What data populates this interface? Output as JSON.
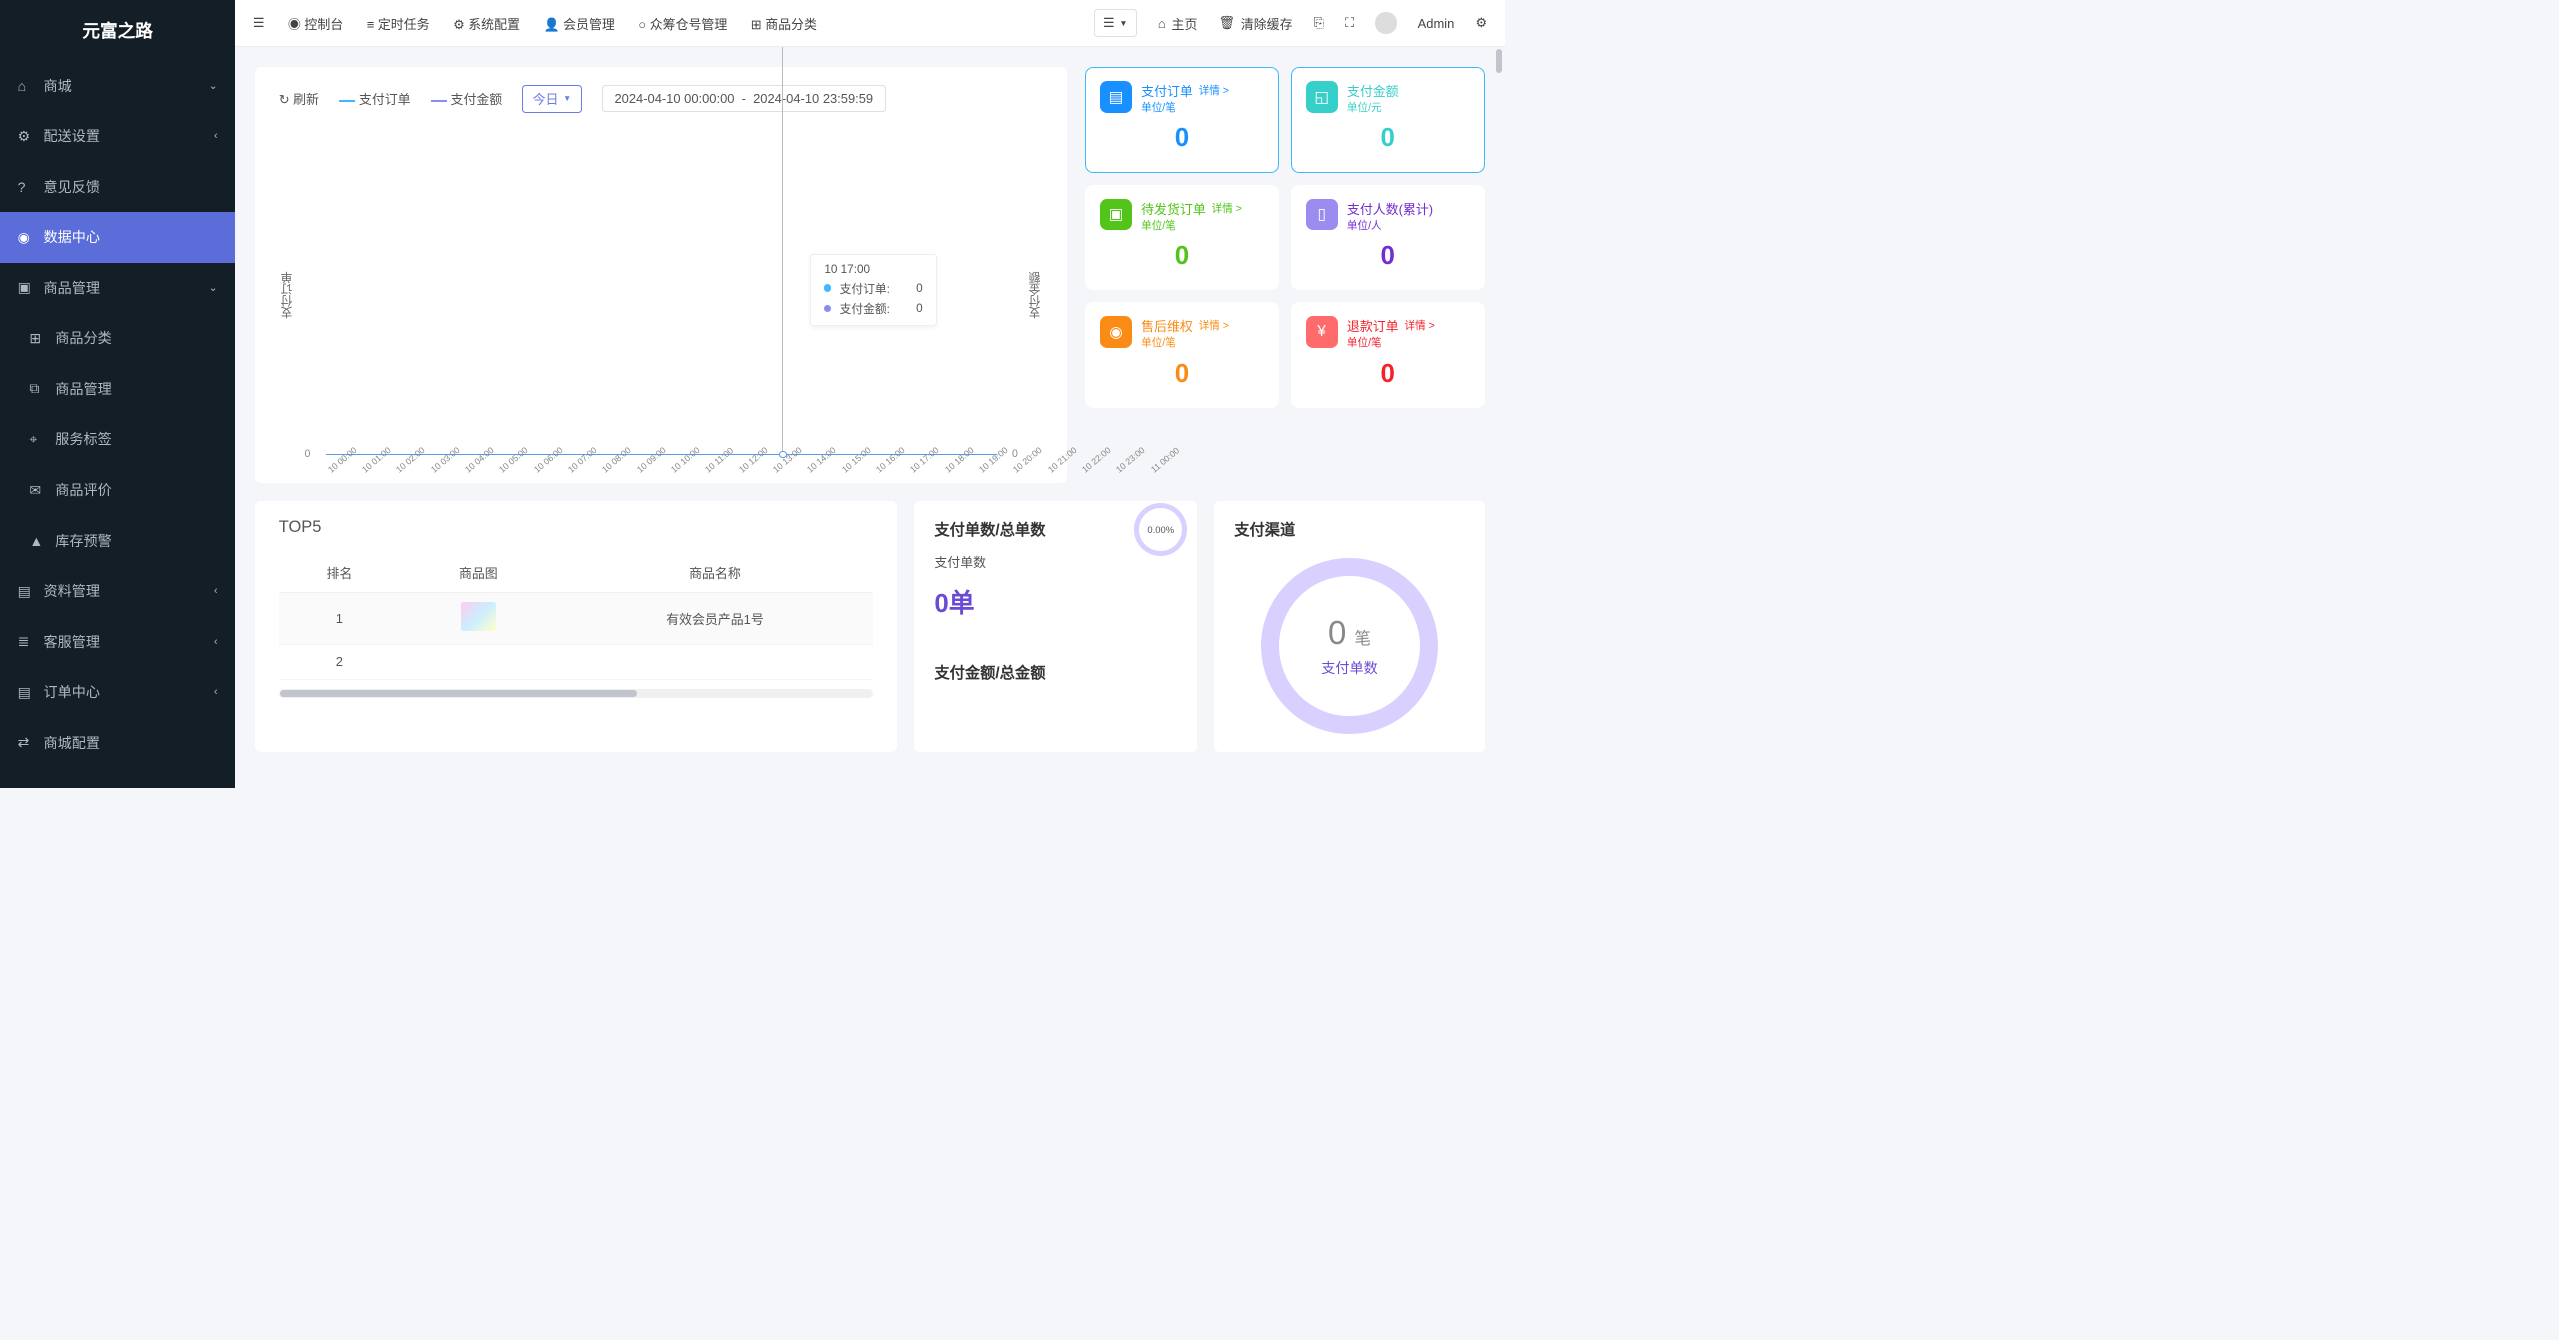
{
  "brand": "元富之路",
  "sidebar": {
    "items": [
      {
        "label": "商城",
        "icon": "home",
        "arrow": "⌄"
      },
      {
        "label": "配送设置",
        "icon": "gear",
        "arrow": "‹"
      },
      {
        "label": "意见反馈",
        "icon": "help",
        "arrow": ""
      },
      {
        "label": "数据中心",
        "icon": "dash",
        "arrow": ""
      },
      {
        "label": "商品管理",
        "icon": "box",
        "arrow": "⌄"
      },
      {
        "label": "商品分类",
        "icon": "tree",
        "arrow": "",
        "sub": true
      },
      {
        "label": "商品管理",
        "icon": "bag",
        "arrow": "",
        "sub": true
      },
      {
        "label": "服务标签",
        "icon": "tag",
        "arrow": "",
        "sub": true
      },
      {
        "label": "商品评价",
        "icon": "chat",
        "arrow": "",
        "sub": true
      },
      {
        "label": "库存预警",
        "icon": "warn",
        "arrow": "",
        "sub": true
      },
      {
        "label": "资料管理",
        "icon": "file",
        "arrow": "‹"
      },
      {
        "label": "客服管理",
        "icon": "list",
        "arrow": "‹"
      },
      {
        "label": "订单中心",
        "icon": "file",
        "arrow": "‹"
      },
      {
        "label": "商城配置",
        "icon": "sliders",
        "arrow": ""
      }
    ],
    "active_index": 3
  },
  "topbar": {
    "items": [
      "控制台",
      "定时任务",
      "系统配置",
      "会员管理",
      "众筹仓号管理",
      "商品分类"
    ],
    "home": "主页",
    "clear_cache": "清除缓存",
    "user": "Admin"
  },
  "chart_controls": {
    "refresh": "刷新",
    "series_a": "支付订单",
    "series_b": "支付金额",
    "range_btn": "今日",
    "date_from": "2024-04-10 00:00:00",
    "date_to": "2024-04-10 23:59:59"
  },
  "chart_data": {
    "type": "line",
    "xlabel": "",
    "y_left_label": "支付订单",
    "y_right_label": "支付金额",
    "y_left_0": "0",
    "y_right_0": "0",
    "categories": [
      "10 00:00",
      "10 01:00",
      "10 02:00",
      "10 03:00",
      "10 04:00",
      "10 05:00",
      "10 06:00",
      "10 07:00",
      "10 08:00",
      "10 09:00",
      "10 10:00",
      "10 11:00",
      "10 12:00",
      "10 13:00",
      "10 14:00",
      "10 15:00",
      "10 16:00",
      "10 17:00",
      "10 18:00",
      "10 19:00",
      "10 20:00",
      "10 21:00",
      "10 22:00",
      "10 23:00",
      "11 00:00"
    ],
    "series": [
      {
        "name": "支付订单",
        "values": [
          0,
          0,
          0,
          0,
          0,
          0,
          0,
          0,
          0,
          0,
          0,
          0,
          0,
          0,
          0,
          0,
          0,
          0,
          0,
          0,
          0,
          0,
          0,
          0,
          0
        ]
      },
      {
        "name": "支付金额",
        "values": [
          0,
          0,
          0,
          0,
          0,
          0,
          0,
          0,
          0,
          0,
          0,
          0,
          0,
          0,
          0,
          0,
          0,
          0,
          0,
          0,
          0,
          0,
          0,
          0,
          0
        ]
      }
    ],
    "tooltip": {
      "time": "10 17:00",
      "rows": [
        {
          "label": "支付订单:",
          "value": "0"
        },
        {
          "label": "支付金额:",
          "value": "0"
        }
      ]
    }
  },
  "stats": [
    {
      "title": "支付订单",
      "unit": "单位/笔",
      "detail": "详情 >",
      "value": "0",
      "color": "blue",
      "icon": "file",
      "active": true
    },
    {
      "title": "支付金额",
      "unit": "单位/元",
      "detail": "",
      "value": "0",
      "color": "cyan",
      "icon": "wallet",
      "active": true
    },
    {
      "title": "待发货订单",
      "unit": "单位/笔",
      "detail": "详情 >",
      "value": "0",
      "color": "green",
      "icon": "box"
    },
    {
      "title": "支付人数(累计)",
      "unit": "单位/人",
      "detail": "",
      "value": "0",
      "color": "purple",
      "icon": "bar"
    },
    {
      "title": "售后维权",
      "unit": "单位/笔",
      "detail": "详情 >",
      "value": "0",
      "color": "orange",
      "icon": "shield"
    },
    {
      "title": "退款订单",
      "unit": "单位/笔",
      "detail": "详情 >",
      "value": "0",
      "color": "red",
      "icon": "yen"
    }
  ],
  "top5": {
    "title": "TOP5",
    "headers": [
      "排名",
      "商品图",
      "商品名称"
    ],
    "rows": [
      {
        "rank": "1",
        "name": "有效会员产品1号"
      },
      {
        "rank": "2",
        "name": ""
      }
    ]
  },
  "ratio": {
    "title1": "支付单数/总单数",
    "pct": "0.00%",
    "sub_label": "支付单数",
    "big_value": "0单",
    "title2": "支付金额/总金额"
  },
  "channel": {
    "title": "支付渠道",
    "num": "0",
    "unit": "笔",
    "label": "支付单数"
  }
}
